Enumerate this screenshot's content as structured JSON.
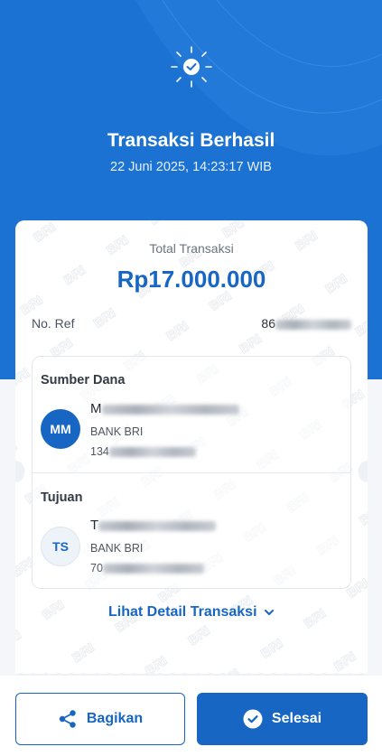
{
  "header": {
    "title": "Transaksi Berhasil",
    "datetime": "22 Juni 2025, 14:23:17 WIB",
    "icon": "check-burst-icon"
  },
  "summary": {
    "total_label": "Total Transaksi",
    "total_amount": "Rp17.000.000",
    "ref_label": "No. Ref",
    "ref_value_visible": "86"
  },
  "source": {
    "title": "Sumber Dana",
    "initials": "MM",
    "name_visible": "M",
    "bank": "BANK BRI",
    "account_visible": "134"
  },
  "destination": {
    "title": "Tujuan",
    "initials": "TS",
    "name_visible": "T",
    "bank": "BANK BRI",
    "account_visible": "70"
  },
  "detail_link": {
    "label": "Lihat Detail Transaksi",
    "icon": "chevron-down-icon"
  },
  "watermark_text": "BRI",
  "actions": {
    "share_label": "Bagikan",
    "share_icon": "share-icon",
    "done_label": "Selesai",
    "done_icon": "check-circle-icon"
  },
  "colors": {
    "primary": "#1766c4",
    "hero": "#1c72d2"
  }
}
